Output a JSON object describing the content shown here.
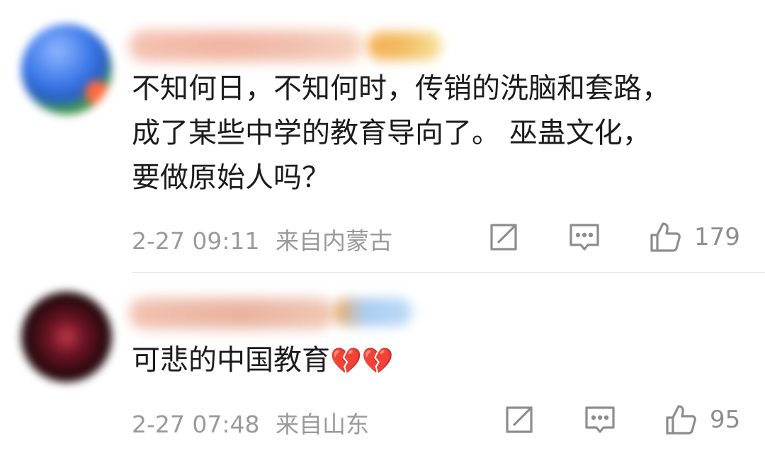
{
  "comments": [
    {
      "text_lines": [
        "不知何日，不知何时，传销的洗脑和套路，",
        "成了某些中学的教育导向了。 巫蛊文化，",
        "要做原始人吗？"
      ],
      "date": "2-27 09:11",
      "location": "来自内蒙古",
      "likes": "179"
    },
    {
      "text": "可悲的中国教育",
      "emoji": "💔💔",
      "date": "2-27 07:48",
      "location": "来自山东",
      "likes": "95"
    }
  ]
}
